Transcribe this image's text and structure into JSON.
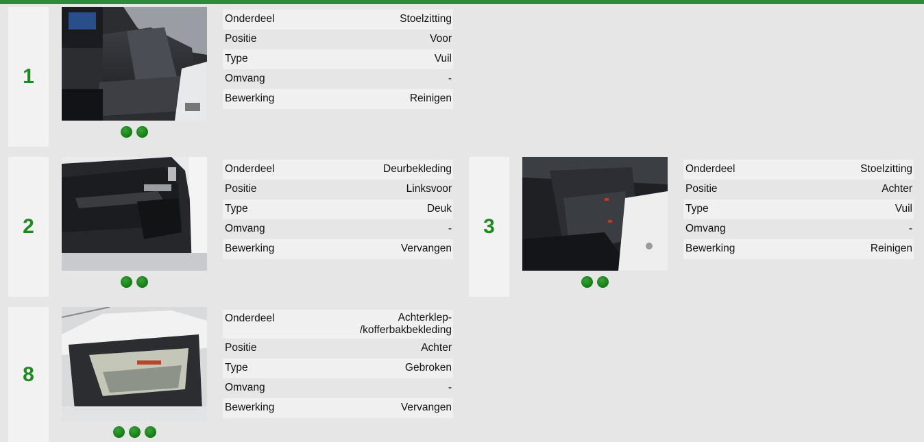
{
  "colors": {
    "accent": "#2e8b3e",
    "number": "#1e8a1e",
    "dot": "#1e8a1e"
  },
  "damages": [
    {
      "number": "1",
      "photo": "front-seat-photo",
      "photo_count": 2,
      "fields": [
        {
          "label": "Onderdeel",
          "value": "Stoelzitting"
        },
        {
          "label": "Positie",
          "value": "Voor"
        },
        {
          "label": "Type",
          "value": "Vuil"
        },
        {
          "label": "Omvang",
          "value": "-"
        },
        {
          "label": "Bewerking",
          "value": "Reinigen"
        }
      ]
    },
    {
      "number": "2",
      "photo": "door-panel-photo",
      "photo_count": 2,
      "fields": [
        {
          "label": "Onderdeel",
          "value": "Deurbekleding"
        },
        {
          "label": "Positie",
          "value": "Linksvoor"
        },
        {
          "label": "Type",
          "value": "Deuk"
        },
        {
          "label": "Omvang",
          "value": "-"
        },
        {
          "label": "Bewerking",
          "value": "Vervangen"
        }
      ]
    },
    {
      "number": "3",
      "photo": "rear-seat-photo",
      "photo_count": 2,
      "fields": [
        {
          "label": "Onderdeel",
          "value": "Stoelzitting"
        },
        {
          "label": "Positie",
          "value": "Achter"
        },
        {
          "label": "Type",
          "value": "Vuil"
        },
        {
          "label": "Omvang",
          "value": "-"
        },
        {
          "label": "Bewerking",
          "value": "Reinigen"
        }
      ]
    },
    {
      "number": "8",
      "photo": "tailgate-photo",
      "photo_count": 3,
      "fields": [
        {
          "label": "Onderdeel",
          "value_line1": "Achterklep-",
          "value_line2": "/kofferbakbekleding"
        },
        {
          "label": "Positie",
          "value": "Achter"
        },
        {
          "label": "Type",
          "value": "Gebroken"
        },
        {
          "label": "Omvang",
          "value": "-"
        },
        {
          "label": "Bewerking",
          "value": "Vervangen"
        }
      ]
    }
  ]
}
